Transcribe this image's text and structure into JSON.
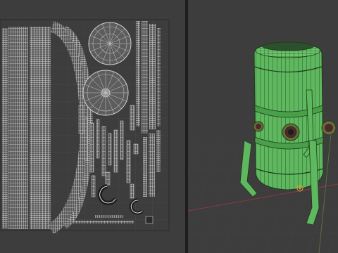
{
  "app": {
    "left_panel": "uv-editor",
    "right_panel": "3d-viewport"
  },
  "colors": {
    "background": "#3d3d3d",
    "grid": "#474747",
    "uv_island_fill": "#5f5f5f",
    "uv_wire": "#d8d8d8",
    "model_green": "#5fb85f",
    "model_wire": "#1c3a1c",
    "axis_x": "#8a3a44",
    "axis_y": "#5b6e3a"
  },
  "icons": {
    "origin": "origin-marker-icon"
  }
}
